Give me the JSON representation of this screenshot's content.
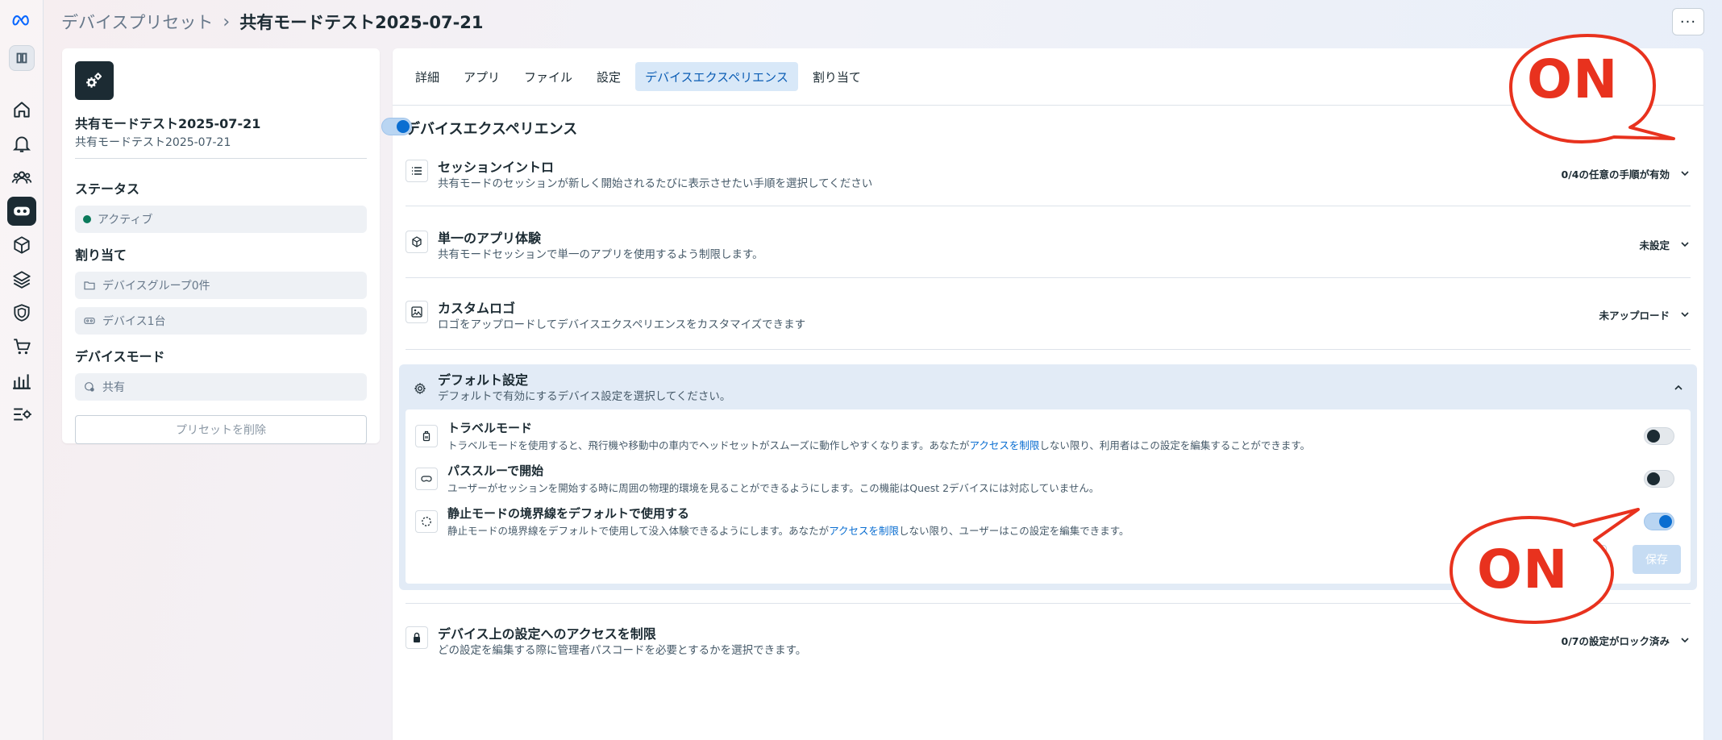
{
  "header": {
    "breadcrumb_parent": "デバイスプリセット",
    "breadcrumb_sep": "›",
    "breadcrumb_current": "共有モードテスト2025-07-21",
    "more_label": "···"
  },
  "rail": {
    "items": [
      "meta-logo",
      "workspace",
      "home",
      "notifications",
      "people",
      "headset",
      "apps",
      "layers",
      "shield",
      "cart",
      "analytics",
      "settings-list"
    ],
    "active": "headset"
  },
  "summary": {
    "name": "共有モードテスト2025-07-21",
    "subname": "共有モードテスト2025-07-21",
    "status_label": "ステータス",
    "status_value": "アクティブ",
    "assign_label": "割り当て",
    "assign_groups": "デバイスグループ0件",
    "assign_devices": "デバイス1台",
    "mode_label": "デバイスモード",
    "mode_value": "共有",
    "delete_label": "プリセットを削除"
  },
  "tabs": [
    {
      "label": "詳細"
    },
    {
      "label": "アプリ"
    },
    {
      "label": "ファイル"
    },
    {
      "label": "設定"
    },
    {
      "label": "デバイスエクスペリエンス",
      "active": true
    },
    {
      "label": "割り当て"
    }
  ],
  "main": {
    "title": "デバイスエクスペリエンス",
    "master_toggle_on": true,
    "rows": {
      "session_intro": {
        "title": "セッションイントロ",
        "desc": "共有モードのセッションが新しく開始されるたびに表示させたい手順を選択してください",
        "status": "0/4の任意の手順が有効"
      },
      "single_app": {
        "title": "単一のアプリ体験",
        "desc": "共有モードセッションで単一のアプリを使用するよう制限します。",
        "status": "未設定"
      },
      "custom_logo": {
        "title": "カスタムロゴ",
        "desc": "ロゴをアップロードしてデバイスエクスペリエンスをカスタマイズできます",
        "status": "未アップロード"
      },
      "defaults": {
        "title": "デフォルト設定",
        "desc": "デフォルトで有効にするデバイス設定を選択してください。"
      },
      "restrict": {
        "title": "デバイス上の設定へのアクセスを制限",
        "desc": "どの設定を編集する際に管理者パスコードを必要とするかを選択できます。",
        "status": "0/7の設定がロック済み"
      }
    },
    "defaults_items": {
      "travel": {
        "title": "トラベルモード",
        "desc_a": "トラベルモードを使用すると、飛行機や移動中の車内でヘッドセットがスムーズに動作しやすくなります。あなたが",
        "link": "アクセスを制限",
        "desc_b": "しない限り、利用者はこの設定を編集することができます。",
        "on": false
      },
      "passthrough": {
        "title": "パススルーで開始",
        "desc": "ユーザーがセッションを開始する時に周囲の物理的環境を見ることができるようにします。この機能はQuest 2デバイスには対応していません。",
        "on": false
      },
      "stationary": {
        "title": "静止モードの境界線をデフォルトで使用する",
        "desc_a": "静止モードの境界線をデフォルトで使用して没入体験できるようにします。あなたが",
        "link": "アクセスを制限",
        "desc_b": "しない限り、ユーザーはこの設定を編集できます。",
        "on": true
      }
    },
    "save_label": "保存"
  },
  "callouts": [
    "ON",
    "ON"
  ],
  "colors": {
    "accent": "#0a6ed1",
    "callout": "#e8321e",
    "active_tab_bg": "#d8e8f8"
  }
}
